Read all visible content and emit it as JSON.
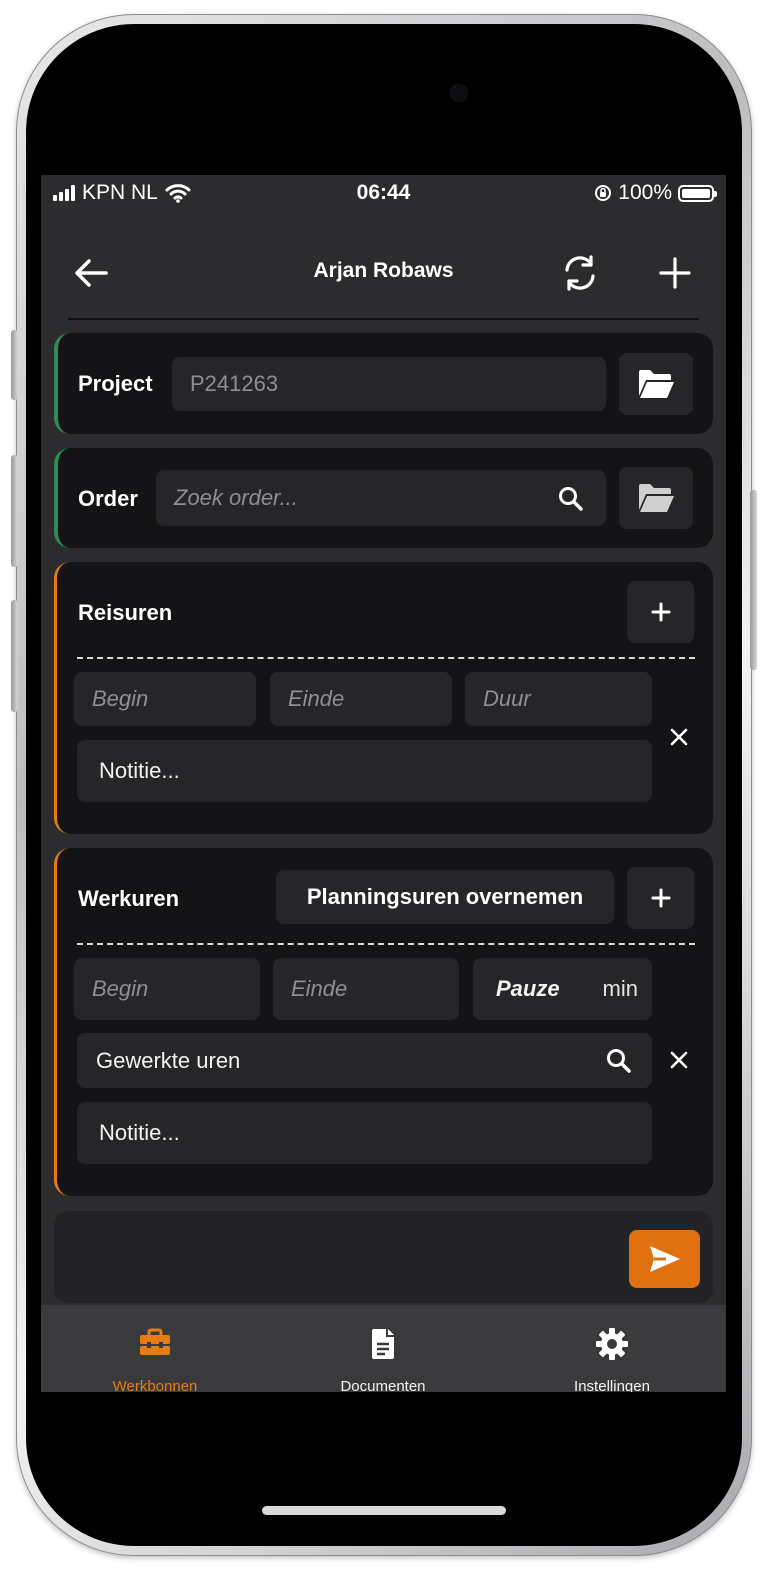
{
  "status_bar": {
    "carrier": "KPN NL",
    "time": "06:44",
    "battery": "100%"
  },
  "header": {
    "title": "Arjan Robaws"
  },
  "project": {
    "label": "Project",
    "value": "P241263"
  },
  "order": {
    "label": "Order",
    "placeholder": "Zoek order..."
  },
  "reisuren": {
    "label": "Reisuren",
    "begin_placeholder": "Begin",
    "einde_placeholder": "Einde",
    "duur_placeholder": "Duur",
    "note_placeholder": "Notitie..."
  },
  "werkuren": {
    "label": "Werkuren",
    "planning_button": "Planningsuren overnemen",
    "begin_placeholder": "Begin",
    "einde_placeholder": "Einde",
    "pauze_label": "Pauze",
    "pauze_unit": "min",
    "gewerkte_uren_placeholder": "Gewerkte uren",
    "note_placeholder": "Notitie..."
  },
  "tabs": [
    {
      "label": "Werkbonnen",
      "icon": "toolbox-icon",
      "active": true
    },
    {
      "label": "Documenten",
      "icon": "document-icon",
      "active": false
    },
    {
      "label": "Instellingen",
      "icon": "gear-icon",
      "active": false
    }
  ],
  "colors": {
    "accent": "#e57d12",
    "green_accent": "#2e8b57",
    "background": "#2c2c2e",
    "card": "#141416"
  }
}
